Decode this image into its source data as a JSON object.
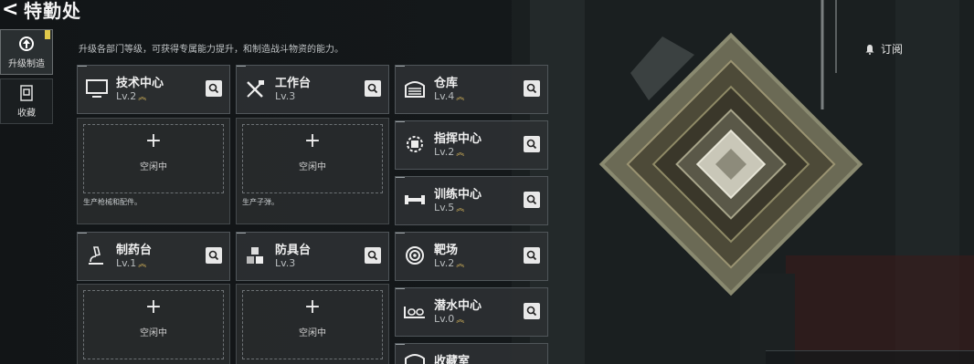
{
  "header": {
    "back_icon": "chevron-left-icon",
    "title": "特勤处"
  },
  "rail": {
    "items": [
      {
        "label": "升级制造",
        "icon": "upgrade-icon",
        "active": true,
        "badge": true
      },
      {
        "label": "收藏",
        "icon": "collection-icon",
        "active": false,
        "badge": false
      }
    ]
  },
  "subtitle": "升级各部门等级，可获得专属能力提升，和制造战斗物资的能力。",
  "subscribe": {
    "label": "订阅",
    "icon": "bell-icon"
  },
  "buildings": {
    "tech": {
      "name": "技术中心",
      "level": "Lv.2",
      "icon": "monitor-icon",
      "upgradable": true
    },
    "workbench": {
      "name": "工作台",
      "level": "Lv.3",
      "icon": "tools-icon",
      "upgradable": false
    },
    "warehouse": {
      "name": "仓库",
      "level": "Lv.4",
      "icon": "garage-icon",
      "upgradable": true
    },
    "command": {
      "name": "指挥中心",
      "level": "Lv.2",
      "icon": "chip-icon",
      "upgradable": true
    },
    "training": {
      "name": "训练中心",
      "level": "Lv.5",
      "icon": "dumbbell-icon",
      "upgradable": true
    },
    "pharmacy": {
      "name": "制药台",
      "level": "Lv.1",
      "icon": "microscope-icon",
      "upgradable": true
    },
    "armor": {
      "name": "防具台",
      "level": "Lv.3",
      "icon": "blocks-icon",
      "upgradable": false
    },
    "range": {
      "name": "靶场",
      "level": "Lv.2",
      "icon": "target-icon",
      "upgradable": true
    },
    "dive": {
      "name": "潜水中心",
      "level": "Lv.0",
      "icon": "goggles-icon",
      "upgradable": true
    },
    "collection": {
      "name": "收藏室",
      "level": "",
      "icon": "vault-icon",
      "upgradable": false
    }
  },
  "slots": {
    "tech": {
      "plus": "+",
      "status": "空闲中",
      "desc": "生产枪械和配件。"
    },
    "workbench": {
      "plus": "+",
      "status": "空闲中",
      "desc": "生产子弹。"
    },
    "pharmacy": {
      "plus": "+",
      "status": "空闲中",
      "desc": ""
    },
    "armor": {
      "plus": "+",
      "status": "空闲中",
      "desc": ""
    }
  },
  "colors": {
    "accent_gold": "#d8b65a",
    "badge_yellow": "#e0c84a",
    "card_bg": "#2c3032"
  }
}
